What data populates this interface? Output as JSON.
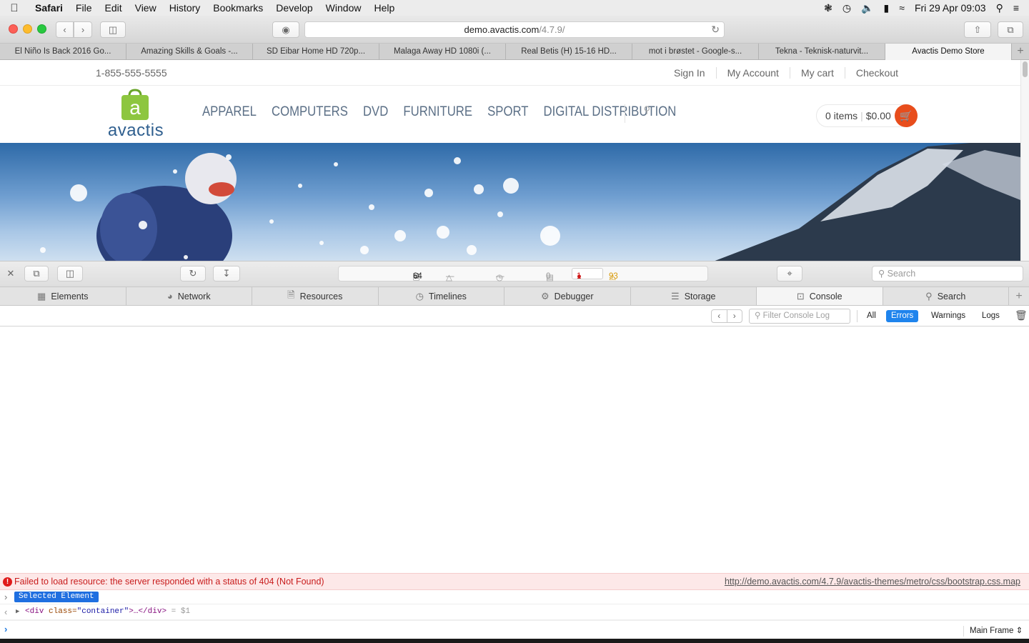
{
  "menubar": {
    "app": "Safari",
    "items": [
      "File",
      "Edit",
      "View",
      "History",
      "Bookmarks",
      "Develop",
      "Window",
      "Help"
    ],
    "clock": "Fri 29 Apr  09:03"
  },
  "browser": {
    "url_host": "demo.avactis.com",
    "url_path": "/4.7.9/",
    "tabs": [
      {
        "label": "El Niño Is Back 2016 Go..."
      },
      {
        "label": "Amazing Skills & Goals -..."
      },
      {
        "label": "SD Eibar Home HD 720p..."
      },
      {
        "label": "Malaga Away HD 1080i (..."
      },
      {
        "label": "Real Betis (H) 15-16 HD..."
      },
      {
        "label": "mot i brøstet - Google-s..."
      },
      {
        "label": "Tekna - Teknisk-naturvit..."
      },
      {
        "label": "Avactis Demo Store"
      }
    ]
  },
  "store": {
    "phone": "1-855-555-5555",
    "links": [
      "Sign In",
      "My Account",
      "My cart",
      "Checkout"
    ],
    "logo_text": "avactis",
    "nav": [
      "APPAREL",
      "COMPUTERS",
      "DVD",
      "FURNITURE",
      "SPORT",
      "DIGITAL DISTRIBUTION"
    ],
    "cart_items": "0 items",
    "cart_total": "$0.00",
    "brand_colors": {
      "green": "#8dc63f",
      "orange": "#e84d1c",
      "blue": "#2f5f8f"
    }
  },
  "devtools": {
    "resources_count": "64",
    "dash1": "—",
    "dash2": "—",
    "messages_count": "0",
    "errors_count": "1",
    "warnings_count": "93",
    "search_placeholder": "Search",
    "tabs": [
      {
        "label": "Elements",
        "icon": "elements-icon"
      },
      {
        "label": "Network",
        "icon": "network-icon"
      },
      {
        "label": "Resources",
        "icon": "resources-icon"
      },
      {
        "label": "Timelines",
        "icon": "timelines-icon"
      },
      {
        "label": "Debugger",
        "icon": "debugger-icon"
      },
      {
        "label": "Storage",
        "icon": "storage-icon"
      },
      {
        "label": "Console",
        "icon": "console-icon"
      },
      {
        "label": "Search",
        "icon": "search-icon"
      }
    ],
    "filter_placeholder": "Filter Console Log",
    "filters": [
      "All",
      "Errors",
      "Warnings",
      "Logs"
    ],
    "active_filter": "Errors",
    "console": {
      "error_message": "Failed to load resource: the server responded with a status of 404 (Not Found)",
      "error_url": "http://demo.avactis.com/4.7.9/avactis-themes/metro/css/bootstrap.css.map",
      "selected_label": "Selected Element",
      "dom_open": "<div",
      "dom_attr": "class=",
      "dom_val": "\"container\"",
      "dom_close": ">…</div>",
      "dom_eq": "= $1",
      "frame": "Main Frame"
    }
  }
}
